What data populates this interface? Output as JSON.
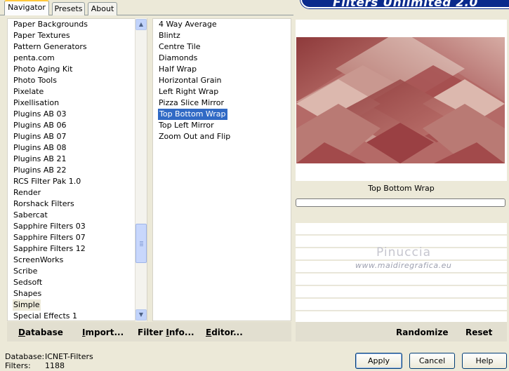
{
  "tabs": [
    "Navigator",
    "Presets",
    "About"
  ],
  "banner": {
    "title": "Filters Unlimited 2.0"
  },
  "categories": [
    "Paper Backgrounds",
    "Paper Textures",
    "Pattern Generators",
    "penta.com",
    "Photo Aging Kit",
    "Photo Tools",
    "Pixelate",
    "Pixellisation",
    "Plugins AB 03",
    "Plugins AB 06",
    "Plugins AB 07",
    "Plugins AB 08",
    "Plugins AB 21",
    "Plugins AB 22",
    "RCS Filter Pak 1.0",
    "Render",
    "Rorshack Filters",
    "Sabercat",
    "Sapphire Filters 03",
    "Sapphire Filters 07",
    "Sapphire Filters 12",
    "ScreenWorks",
    "Scribe",
    "Sedsoft",
    "Shapes",
    "Simple",
    "Special Effects 1"
  ],
  "filters": [
    "4 Way Average",
    "Blintz",
    "Centre Tile",
    "Diamonds",
    "Half Wrap",
    "Horizontal Grain",
    "Left Right Wrap",
    "Pizza Slice Mirror",
    "Top Bottom Wrap",
    "Top Left Mirror",
    "Zoom Out and Flip"
  ],
  "selected_category": "Simple",
  "selected_filter": "Top Bottom Wrap",
  "bottom_links": {
    "database": "Database",
    "import": "Import...",
    "filter_info": "Filter Info...",
    "editor": "Editor...",
    "randomize": "Randomize",
    "reset": "Reset"
  },
  "preview": {
    "filter_name": "Top Bottom Wrap"
  },
  "watermark": {
    "line1": "Pinuccia",
    "line2": "www.maidiregrafica.eu"
  },
  "status": {
    "database_label": "Database:",
    "database_value": "ICNET-Filters",
    "filters_label": "Filters:",
    "filters_value": "1188"
  },
  "buttons": {
    "apply": "Apply",
    "cancel": "Cancel",
    "help": "Help"
  },
  "colors": {
    "window_bg": "#ece9d8",
    "selection": "#316ac5",
    "banner": "#0a2a8c",
    "art_dark": "#9b3f3f",
    "art_light": "#cfaaa2"
  }
}
